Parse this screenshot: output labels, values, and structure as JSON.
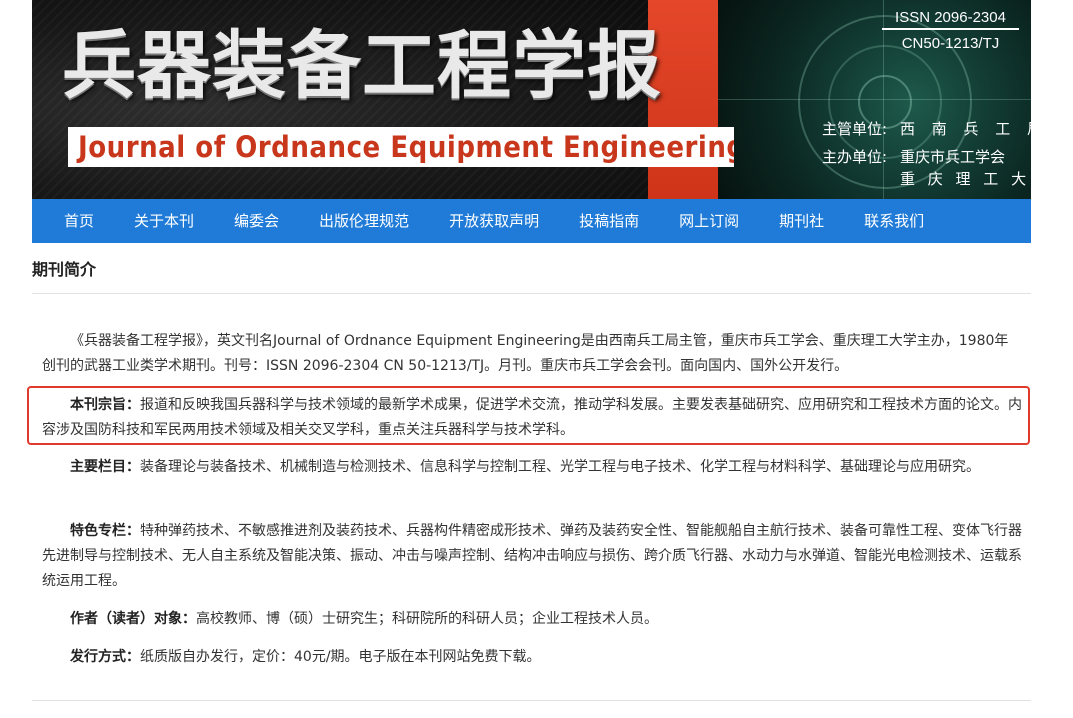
{
  "banner": {
    "title_cn": "兵器装备工程学报",
    "title_en": "Journal of Ordnance  Equipment  Engineering",
    "issn": "ISSN 2096-2304",
    "cn": "CN50-1213/TJ",
    "supervisor_label": "主管单位:",
    "supervisor_value": "西 南 兵 工 局",
    "sponsor_label": "主办单位:",
    "sponsor_value_1": "重庆市兵工学会",
    "sponsor_value_2": "重 庆 理 工 大 学",
    "colors": {
      "red_panel": "#d63a1f",
      "title_en": "#c8371c"
    }
  },
  "nav": {
    "color": "#1f7bd7",
    "items": [
      {
        "label": "首页"
      },
      {
        "label": "关于本刊"
      },
      {
        "label": "编委会"
      },
      {
        "label": "出版伦理规范"
      },
      {
        "label": "开放获取声明"
      },
      {
        "label": "投稿指南"
      },
      {
        "label": "网上订阅"
      },
      {
        "label": "期刊社"
      },
      {
        "label": "联系我们"
      }
    ]
  },
  "content": {
    "section_title": "期刊简介",
    "intro": "《兵器装备工程学报》，英文刊名Journal of Ordnance Equipment Engineering是由西南兵工局主管，重庆市兵工学会、重庆理工大学主办，1980年创刊的武器工业类学术期刊。刊号：ISSN 2096-2304  CN 50-1213/TJ。月刊。重庆市兵工学会会刊。面向国内、国外公开发行。",
    "aim": {
      "label": "本刊宗旨：",
      "text": "报道和反映我国兵器科学与技术领域的最新学术成果，促进学术交流，推动学科发展。主要发表基础研究、应用研究和工程技术方面的论文。内容涉及国防科技和军民两用技术领域及相关交叉学科，重点关注兵器科学与技术学科。"
    },
    "columns": {
      "label": "主要栏目：",
      "text": "装备理论与装备技术、机械制造与检测技术、信息科学与控制工程、光学工程与电子技术、化学工程与材料科学、基础理论与应用研究。"
    },
    "featured": {
      "label": "特色专栏：",
      "text": "特种弹药技术、不敏感推进剂及装药技术、兵器构件精密成形技术、弹药及装药安全性、智能舰船自主航行技术、装备可靠性工程、变体飞行器先进制导与控制技术、无人自主系统及智能决策、振动、冲击与噪声控制、结构冲击响应与损伤、跨介质飞行器、水动力与水弹道、智能光电检测技术、运载系统运用工程。"
    },
    "audience": {
      "label": "作者（读者）对象：",
      "text": "高校教师、博（硕）士研究生；科研院所的科研人员；企业工程技术人员。"
    },
    "distribution": {
      "label": "发行方式：",
      "text": "纸质版自办发行，定价：40元/期。电子版在本刊网站免费下载。"
    },
    "highlight_color": "#e03a2d"
  }
}
